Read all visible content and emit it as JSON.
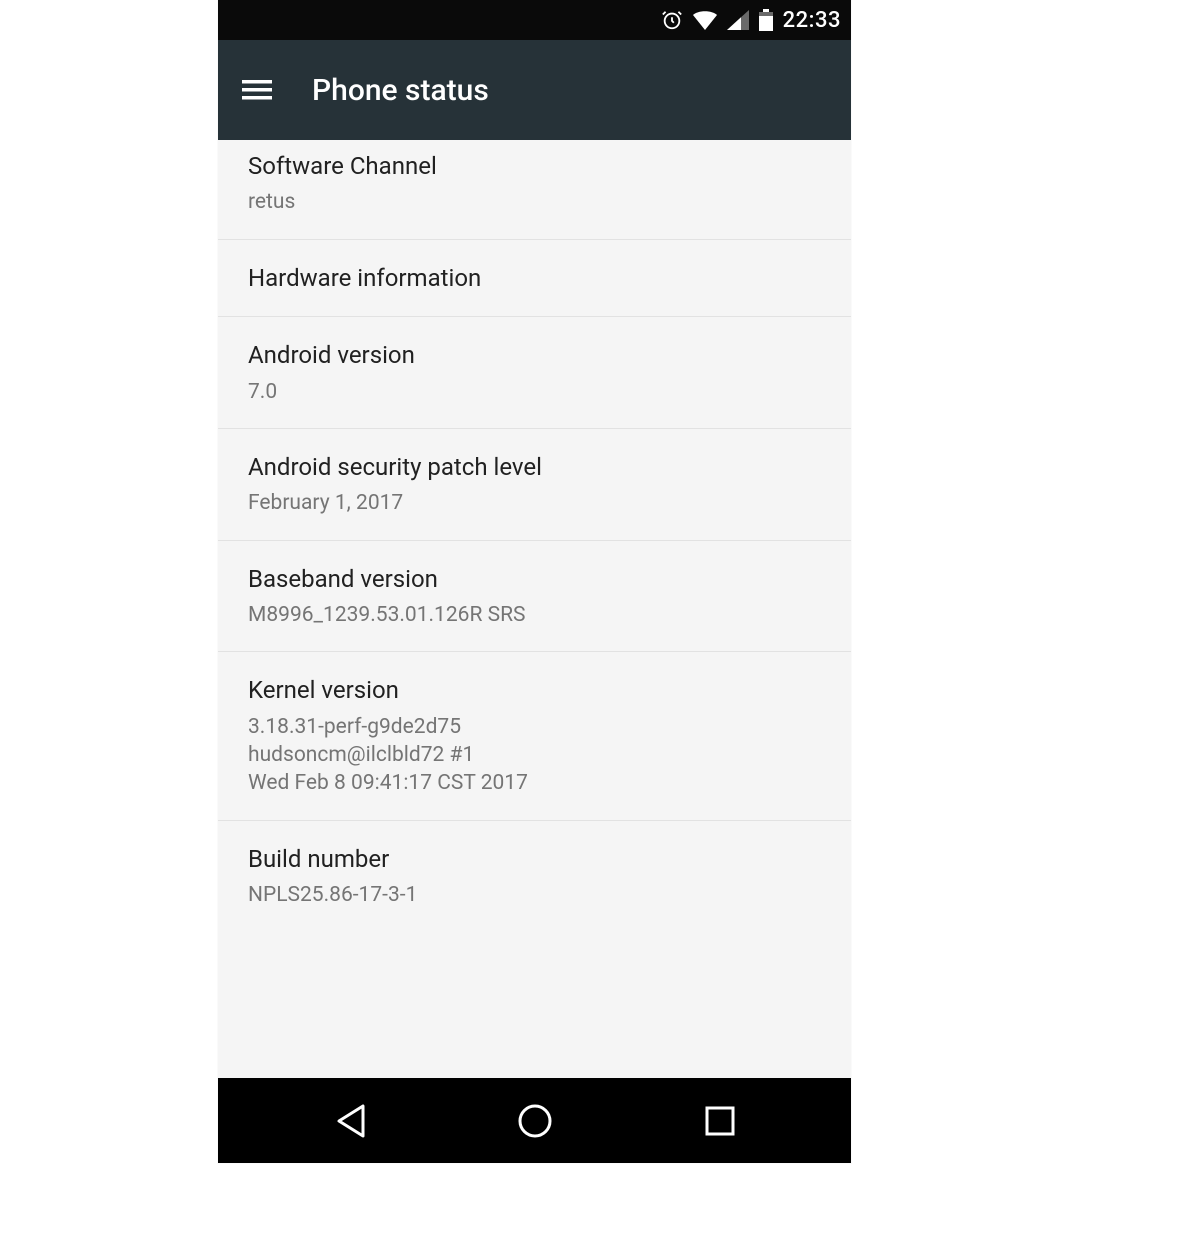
{
  "statusbar": {
    "time": "22:33"
  },
  "appbar": {
    "title": "Phone status"
  },
  "list": {
    "items": [
      {
        "label": "Software Channel",
        "value": "retus"
      },
      {
        "label": "Hardware information",
        "value": ""
      },
      {
        "label": "Android version",
        "value": "7.0"
      },
      {
        "label": "Android security patch level",
        "value": "February 1, 2017"
      },
      {
        "label": "Baseband version",
        "value": "M8996_1239.53.01.126R SRS"
      },
      {
        "label": "Kernel version",
        "value": "3.18.31-perf-g9de2d75\nhudsoncm@ilclbld72 #1\nWed Feb 8 09:41:17 CST 2017"
      },
      {
        "label": "Build number",
        "value": "NPLS25.86-17-3-1"
      }
    ]
  }
}
